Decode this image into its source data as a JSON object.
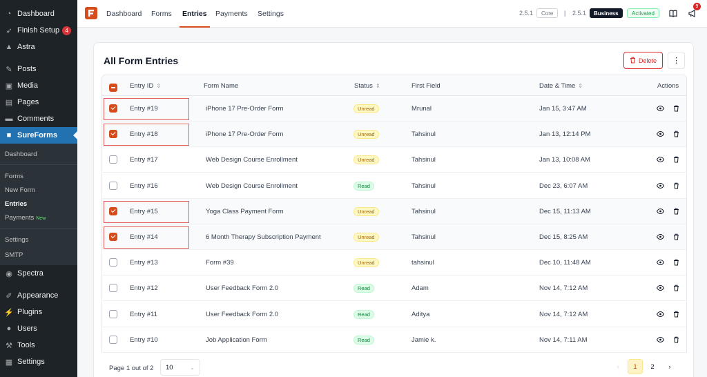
{
  "sidebar": {
    "items": [
      {
        "label": "Dashboard",
        "icon": "dashboard-icon"
      },
      {
        "label": "Finish Setup",
        "icon": "rocket-icon",
        "badge": "4"
      },
      {
        "label": "Astra",
        "icon": "astra-icon"
      },
      {
        "label": "Posts",
        "icon": "pin-icon"
      },
      {
        "label": "Media",
        "icon": "media-icon"
      },
      {
        "label": "Pages",
        "icon": "pages-icon"
      },
      {
        "label": "Comments",
        "icon": "comment-icon"
      },
      {
        "label": "SureForms",
        "icon": "sureforms-icon"
      },
      {
        "label": "Spectra",
        "icon": "spectra-icon"
      },
      {
        "label": "Appearance",
        "icon": "brush-icon"
      },
      {
        "label": "Plugins",
        "icon": "plug-icon"
      },
      {
        "label": "Users",
        "icon": "user-icon"
      },
      {
        "label": "Tools",
        "icon": "wrench-icon"
      },
      {
        "label": "Settings",
        "icon": "settings-icon"
      }
    ],
    "submenu": {
      "dashboard": "Dashboard",
      "forms": "Forms",
      "new_form": "New Form",
      "entries": "Entries",
      "payments": "Payments",
      "payments_badge": "New",
      "settings": "Settings",
      "smtp": "SMTP"
    }
  },
  "topbar": {
    "nav": [
      "Dashboard",
      "Forms",
      "Entries",
      "Payments",
      "Settings"
    ],
    "active_nav": "Entries",
    "core_version": "2.5.1",
    "core_label": "Core",
    "separator": "|",
    "business_version": "2.5.1",
    "business_label": "Business",
    "activated_label": "Activated",
    "notification_count": "9"
  },
  "card": {
    "title": "All Form Entries",
    "delete_label": "Delete",
    "more_glyph": "⋮"
  },
  "table": {
    "headers": {
      "entry_id": "Entry ID",
      "form_name": "Form Name",
      "status": "Status",
      "first_field": "First Field",
      "date_time": "Date & Time",
      "actions": "Actions"
    },
    "rows": [
      {
        "id": "Entry #19",
        "form": "iPhone 17 Pre-Order Form",
        "status": "Unread",
        "field": "Mrunal",
        "date": "Jan 15, 3:47 AM",
        "checked": true
      },
      {
        "id": "Entry #18",
        "form": "iPhone 17 Pre-Order Form",
        "status": "Unread",
        "field": "Tahsinul",
        "date": "Jan 13, 12:14 PM",
        "checked": true
      },
      {
        "id": "Entry #17",
        "form": "Web Design Course Enrollment",
        "status": "Unread",
        "field": "Tahsinul",
        "date": "Jan 13, 10:08 AM",
        "checked": false
      },
      {
        "id": "Entry #16",
        "form": "Web Design Course Enrollment",
        "status": "Read",
        "field": "Tahsinul",
        "date": "Dec 23, 6:07 AM",
        "checked": false
      },
      {
        "id": "Entry #15",
        "form": "Yoga Class Payment Form",
        "status": "Unread",
        "field": "Tahsinul",
        "date": "Dec 15, 11:13 AM",
        "checked": true
      },
      {
        "id": "Entry #14",
        "form": "6 Month Therapy Subscription Payment",
        "status": "Unread",
        "field": "Tahsinul",
        "date": "Dec 15, 8:25 AM",
        "checked": true
      },
      {
        "id": "Entry #13",
        "form": "Form #39",
        "status": "Unread",
        "field": "tahsinul",
        "date": "Dec 10, 11:48 AM",
        "checked": false
      },
      {
        "id": "Entry #12",
        "form": "User Feedback Form 2.0",
        "status": "Read",
        "field": "Adam",
        "date": "Nov 14, 7:12 AM",
        "checked": false
      },
      {
        "id": "Entry #11",
        "form": "User Feedback Form 2.0",
        "status": "Read",
        "field": "Aditya",
        "date": "Nov 14, 7:12 AM",
        "checked": false
      },
      {
        "id": "Entry #10",
        "form": "Job Application Form",
        "status": "Read",
        "field": "Jamie k.",
        "date": "Nov 14, 7:11 AM",
        "checked": false
      }
    ]
  },
  "pagination": {
    "summary": "Page 1 out of 2",
    "per_page": "10",
    "pages": [
      "1",
      "2"
    ],
    "current": "1"
  }
}
